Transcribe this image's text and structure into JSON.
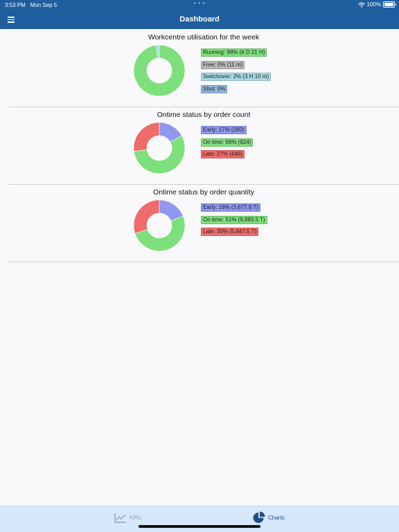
{
  "status_bar": {
    "time": "3:53 PM",
    "date": "Mon Sep 5",
    "dots": "• • •",
    "battery": "100%",
    "battery_level": 1.0
  },
  "header": {
    "title": "Dashboard"
  },
  "sections": [
    {
      "title": "Workcentre utilisation for the week",
      "legend": [
        {
          "label": "Running:  98% (6 D 21 H)",
          "color": "#7ee07a"
        },
        {
          "label": "Free:  0% (11 m)",
          "color": "#b9b9b9"
        },
        {
          "label": "Switchover:  2% (3 H 10 m)",
          "color": "#a9d8e4"
        },
        {
          "label": "Shut:  0%",
          "color": "#8fb5dd"
        }
      ]
    },
    {
      "title": "Ontime status by order count",
      "legend": [
        {
          "label": "Early:  17% (280)",
          "color": "#8f97ee"
        },
        {
          "label": "On time:  56% (924)",
          "color": "#7ee07a"
        },
        {
          "label": "Late:  27% (446)",
          "color": "#f06b6b"
        }
      ]
    },
    {
      "title": "Ontime status by order quantity",
      "legend": [
        {
          "label": "Early:  19% (3,677.9 T)",
          "color": "#8f97ee"
        },
        {
          "label": "On time:  51% (9,883.5 T)",
          "color": "#7ee07a"
        },
        {
          "label": "Late:  30% (5,847.5 T)",
          "color": "#f06b6b"
        }
      ]
    }
  ],
  "chart_data": [
    {
      "type": "pie",
      "title": "Workcentre utilisation for the week",
      "categories": [
        "Running",
        "Free",
        "Switchover",
        "Shut"
      ],
      "values": [
        98,
        0,
        2,
        0
      ],
      "colors": [
        "#7ee07a",
        "#b9b9b9",
        "#a9d8e4",
        "#8fb5dd"
      ]
    },
    {
      "type": "pie",
      "title": "Ontime status by order count",
      "categories": [
        "Early",
        "On time",
        "Late"
      ],
      "values": [
        280,
        924,
        446
      ],
      "colors": [
        "#8f97ee",
        "#7ee07a",
        "#f06b6b"
      ]
    },
    {
      "type": "pie",
      "title": "Ontime status by order quantity",
      "categories": [
        "Early",
        "On time",
        "Late"
      ],
      "values": [
        3677.9,
        9883.5,
        5847.5
      ],
      "colors": [
        "#8f97ee",
        "#7ee07a",
        "#f06b6b"
      ]
    }
  ],
  "tab_bar": {
    "tabs": [
      {
        "label": "KPIs",
        "active": false
      },
      {
        "label": "Charts",
        "active": true
      }
    ]
  },
  "colors": {
    "accent": "#1f5e9e",
    "tab_bar_bg": "#d6e6fb"
  }
}
